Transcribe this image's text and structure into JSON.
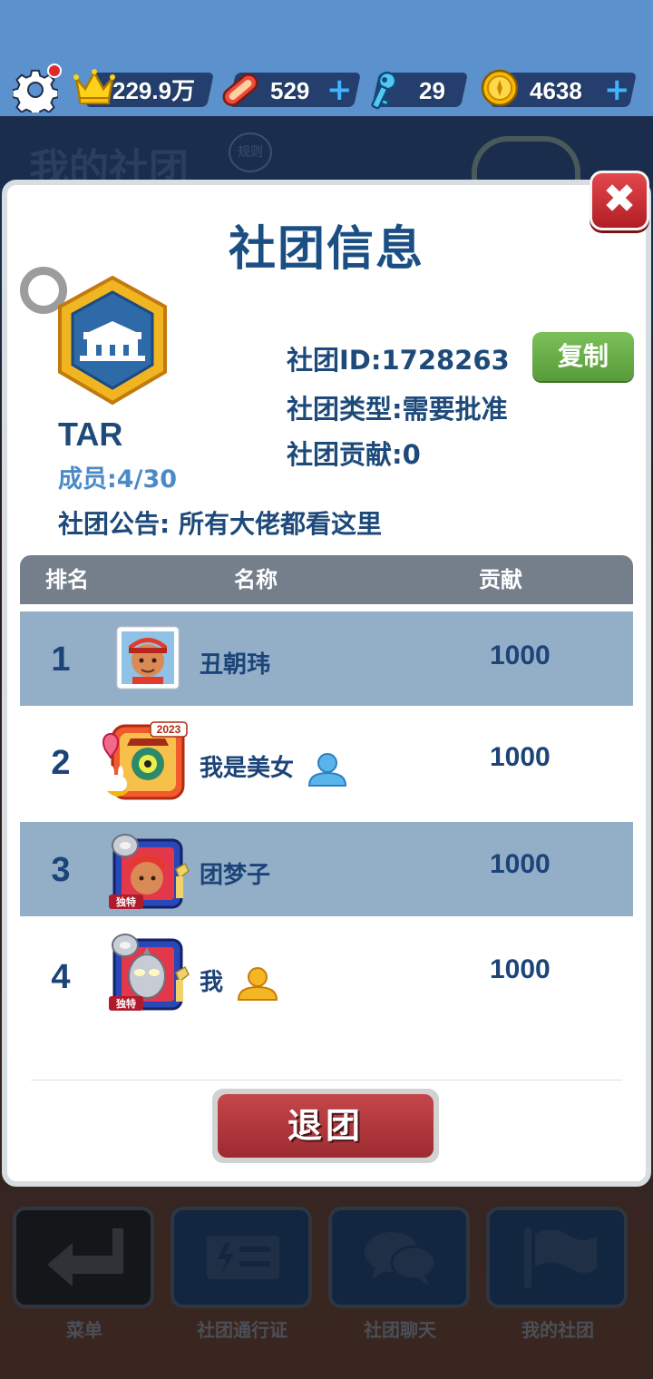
{
  "topbar": {
    "crown_value": "229.9万",
    "boards_value": "529",
    "keys_value": "29",
    "coins_value": "4638",
    "plus": "+"
  },
  "background": {
    "title": "我的社团",
    "rules_label": "规则"
  },
  "modal": {
    "title": "社团信息",
    "close": "✖",
    "club_name": "TAR",
    "members": "成员:4/30",
    "club_id": "社团ID:1728263",
    "copy_label": "复制",
    "club_type": "社团类型:需要批准",
    "contribution": "社团贡献:0",
    "notice": "社团公告: 所有大佬都看这里",
    "table": {
      "headers": [
        "排名",
        "名称",
        "贡献"
      ],
      "rows": [
        {
          "rank": "1",
          "name": "丑朝玮",
          "value": "1000",
          "online_icon": ""
        },
        {
          "rank": "2",
          "name": "我是美女",
          "value": "1000",
          "online_icon": "person-blue-icon"
        },
        {
          "rank": "3",
          "name": "团梦子",
          "value": "1000",
          "online_icon": ""
        },
        {
          "rank": "4",
          "name": "我",
          "value": "1000",
          "online_icon": "person-gold-icon"
        }
      ],
      "avatar_badges": {
        "year_badge": "2023",
        "frame_tag": "独特"
      }
    },
    "quit_label": "退团"
  },
  "bottom_nav": [
    {
      "label": "菜单",
      "icon": "return-arrow-icon"
    },
    {
      "label": "社团通行证",
      "icon": "ticket-icon"
    },
    {
      "label": "社团聊天",
      "icon": "chat-bubbles-icon"
    },
    {
      "label": "我的社团",
      "icon": "flag-icon"
    }
  ],
  "colors": {
    "sky": "#5b91cd",
    "title_blue": "#1b4f84",
    "row_alt": "#93afc8",
    "header_gray": "#747f8b",
    "copy_green": "#6aae49",
    "quit_red": "#b53a3f",
    "close_red": "#c9313a"
  }
}
